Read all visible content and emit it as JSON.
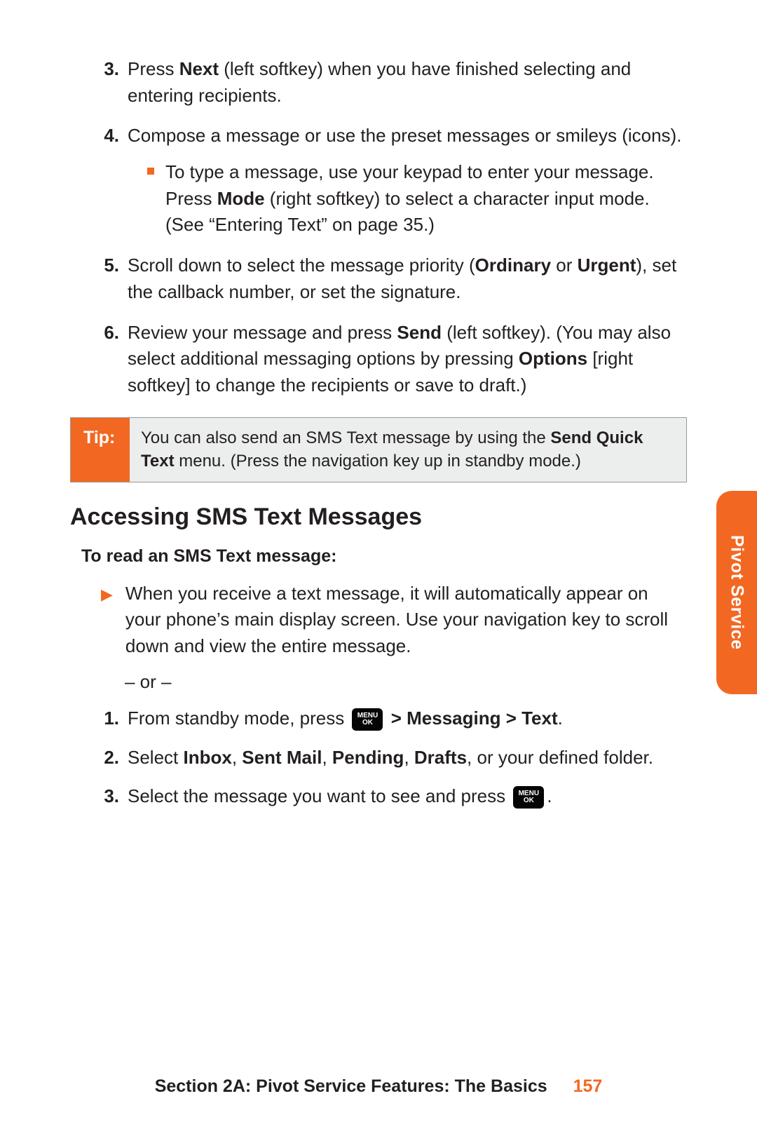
{
  "steps_upper": [
    {
      "num": "3.",
      "html": "Press <b>Next</b> (left softkey) when you have finished selecting and entering recipients."
    },
    {
      "num": "4.",
      "html": "Compose a message or use the preset messages or smileys (icons).",
      "sub": "To type a message, use your keypad to enter your message. Press <b>Mode</b> (right softkey) to select a character input mode. (See “Entering Text” on page 35.)"
    },
    {
      "num": "5.",
      "html": "Scroll down to select the message priority (<b>Ordinary</b> or <b>Urgent</b>), set the callback number, or set the signature."
    },
    {
      "num": "6.",
      "html": "Review your message and press <b>Send</b> (left softkey). (You may also select additional messaging options by pressing <b>Options</b> [right softkey] to change the recipients or save to draft.)"
    }
  ],
  "tip": {
    "label": "Tip:",
    "html": "You can also send an SMS Text message by using the <b>Send Quick Text</b> menu. (Press the navigation key up in standby mode.)"
  },
  "heading": "Accessing SMS Text Messages",
  "subheading": "To read an SMS Text message:",
  "tri_text": "When you receive a text message, it will automatically appear on your phone’s main display screen. Use your navigation key to scroll down and view the entire message.",
  "or_text": "– or –",
  "menu_key": {
    "line1": "MENU",
    "line2": "OK"
  },
  "steps_lower": [
    {
      "num": "1.",
      "pre": "From standby mode, press ",
      "post_html": " <b>> Messaging > Text</b>.",
      "has_key": true
    },
    {
      "num": "2.",
      "html": "Select <b>Inbox</b>, <b>Sent Mail</b>, <b>Pending</b>, <b>Drafts</b>, or your defined folder."
    },
    {
      "num": "3.",
      "pre": "Select the message you want to see and press ",
      "post_html": ".",
      "has_key": true
    }
  ],
  "side_tab": "Pivot Service",
  "footer": {
    "section": "Section 2A: Pivot Service Features: The Basics",
    "page": "157"
  }
}
